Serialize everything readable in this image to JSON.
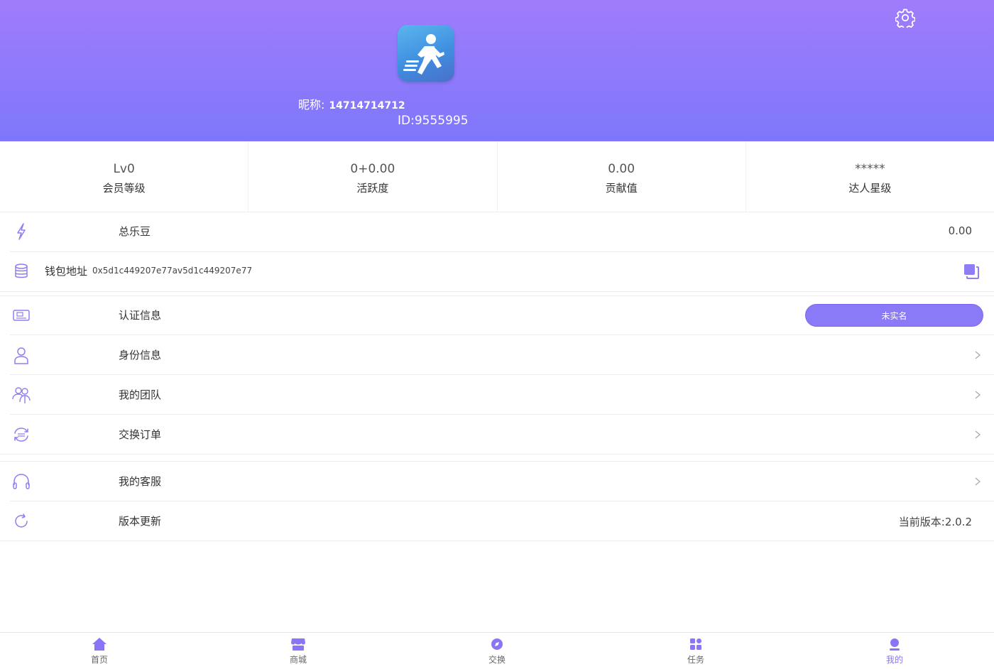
{
  "header": {
    "nickname_label": "昵称:",
    "nickname": "14714714712",
    "user_id": "ID:9555995"
  },
  "stats": [
    {
      "value": "Lv0",
      "label": "会员等级"
    },
    {
      "value": "0+0.00",
      "label": "活跃度"
    },
    {
      "value": "0.00",
      "label": "贡献值"
    },
    {
      "value": "*****",
      "label": "达人星级"
    }
  ],
  "balance": {
    "label": "总乐豆",
    "value": "0.00"
  },
  "wallet": {
    "label": "钱包地址",
    "address": "0x5d1c449207e77av5d1c449207e77"
  },
  "auth": {
    "label": "认证信息",
    "status": "未实名"
  },
  "menu": {
    "identity": "身份信息",
    "team": "我的团队",
    "orders": "交换订单",
    "service": "我的客服",
    "update": "版本更新",
    "version": "当前版本:2.0.2"
  },
  "bottom_nav": [
    {
      "label": "首页",
      "icon": "home-icon"
    },
    {
      "label": "商城",
      "icon": "store-icon"
    },
    {
      "label": "交换",
      "icon": "exchange-icon"
    },
    {
      "label": "任务",
      "icon": "grid-icon"
    },
    {
      "label": "我的",
      "icon": "user-icon"
    }
  ],
  "colors": {
    "accent": "#8b7af7",
    "header_top": "#a07cfb",
    "header_bottom": "#7e77fb",
    "icon": "#8f7df5"
  }
}
